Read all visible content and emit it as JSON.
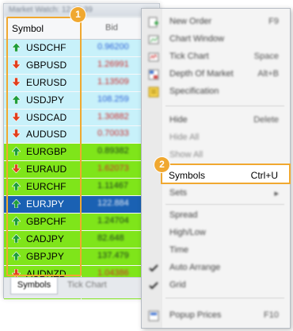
{
  "market_watch": {
    "title": "Market Watch: 12:20:39",
    "header": {
      "symbol": "Symbol",
      "bid": "Bid"
    },
    "rows": [
      {
        "symbol": "USDCHF",
        "bid": "0.96200",
        "dir": "up",
        "color": "cyan",
        "num": "blue"
      },
      {
        "symbol": "GBPUSD",
        "bid": "1.26991",
        "dir": "down",
        "color": "cyan",
        "num": "red"
      },
      {
        "symbol": "EURUSD",
        "bid": "1.13509",
        "dir": "down",
        "color": "cyan",
        "num": "red"
      },
      {
        "symbol": "USDJPY",
        "bid": "108.259",
        "dir": "up",
        "color": "cyan",
        "num": "blue"
      },
      {
        "symbol": "USDCAD",
        "bid": "1.30882",
        "dir": "down",
        "color": "cyan",
        "num": "red"
      },
      {
        "symbol": "AUDUSD",
        "bid": "0.70033",
        "dir": "down",
        "color": "cyan",
        "num": "red"
      },
      {
        "symbol": "EURGBP",
        "bid": "0.89382",
        "dir": "up",
        "color": "green",
        "num": "dark"
      },
      {
        "symbol": "EURAUD",
        "bid": "1.62073",
        "dir": "down",
        "color": "green",
        "num": "red"
      },
      {
        "symbol": "EURCHF",
        "bid": "1.11467",
        "dir": "up",
        "color": "green",
        "num": "dark"
      },
      {
        "symbol": "EURJPY",
        "bid": "122.884",
        "dir": "up",
        "color": "selected",
        "num": "white"
      },
      {
        "symbol": "GBPCHF",
        "bid": "1.24704",
        "dir": "up",
        "color": "green",
        "num": "dark"
      },
      {
        "symbol": "CADJPY",
        "bid": "82.648",
        "dir": "up",
        "color": "green",
        "num": "dark"
      },
      {
        "symbol": "GBPJPY",
        "bid": "137.479",
        "dir": "up",
        "color": "green",
        "num": "dark"
      },
      {
        "symbol": "AUDNZD",
        "bid": "1.04386",
        "dir": "down",
        "color": "green",
        "num": "red"
      },
      {
        "symbol": "AUDCAD",
        "bid": "0.91732",
        "dir": "down",
        "color": "green",
        "num": "red"
      }
    ],
    "tabs": {
      "active": "Symbols",
      "other": "Tick Chart"
    }
  },
  "badges": {
    "one": "1",
    "two": "2"
  },
  "context_menu": {
    "items": [
      {
        "label": "New Order",
        "shortcut": "F9",
        "icon": "new-order-icon"
      },
      {
        "label": "Chart Window",
        "shortcut": "",
        "icon": "chart-window-icon"
      },
      {
        "label": "Tick Chart",
        "shortcut": "Space",
        "icon": "tick-chart-icon"
      },
      {
        "label": "Depth Of Market",
        "shortcut": "Alt+B",
        "icon": "depth-of-market-icon"
      },
      {
        "label": "Specification",
        "shortcut": "",
        "icon": "specification-icon"
      },
      {
        "label": "Hide",
        "shortcut": "Delete",
        "icon": ""
      },
      {
        "label": "Hide All",
        "shortcut": "",
        "icon": ""
      },
      {
        "label": "Show All",
        "shortcut": "",
        "icon": ""
      },
      {
        "label": "Symbols",
        "shortcut": "Ctrl+U",
        "icon": ""
      },
      {
        "label": "Sets",
        "shortcut": "▸",
        "icon": ""
      },
      {
        "label": "Spread",
        "shortcut": "",
        "icon": ""
      },
      {
        "label": "High/Low",
        "shortcut": "",
        "icon": ""
      },
      {
        "label": "Time",
        "shortcut": "",
        "icon": ""
      },
      {
        "label": "Auto Arrange",
        "shortcut": "",
        "icon": "check-icon"
      },
      {
        "label": "Grid",
        "shortcut": "",
        "icon": "check-icon"
      },
      {
        "label": "Popup Prices",
        "shortcut": "F10",
        "icon": "popup-prices-icon"
      }
    ]
  },
  "colors": {
    "accent": "#f0a830",
    "cyan_row": "#c8f1fa",
    "green_row": "#7fe51a",
    "selected_row": "#1a61b3"
  }
}
